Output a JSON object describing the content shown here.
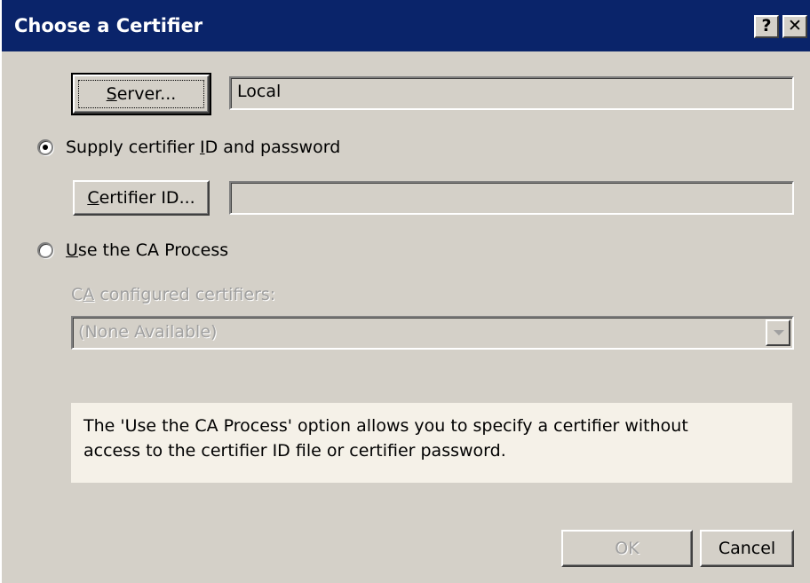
{
  "window": {
    "title": "Choose a Certifier",
    "help_label": "?",
    "close_label": "✕"
  },
  "server": {
    "button_mnemonic": "S",
    "button_rest": "erver...",
    "value": "Local"
  },
  "option_supply": {
    "label_before": "Supply certifier ",
    "label_mnemonic": "I",
    "label_after": "D and password",
    "checked": true
  },
  "certifier_id": {
    "button_mnemonic": "C",
    "button_rest": "ertifier ID...",
    "value": ""
  },
  "option_ca": {
    "label_mnemonic": "U",
    "label_rest": "se the CA Process",
    "checked": false
  },
  "ca_certifiers": {
    "label_mnemonic": "A",
    "label_before": "C",
    "label_after": " configured certifiers:",
    "selected": "(None Available)"
  },
  "info": {
    "line1": "The 'Use the CA Process' option allows you to specify a certifier without",
    "line2": "access to the certifier ID file or certifier password."
  },
  "buttons": {
    "ok": "OK",
    "cancel": "Cancel"
  },
  "colors": {
    "title_bar": "#0a246a",
    "dialog_bg": "#d4d0c8",
    "info_bg": "#f5f1e8"
  }
}
